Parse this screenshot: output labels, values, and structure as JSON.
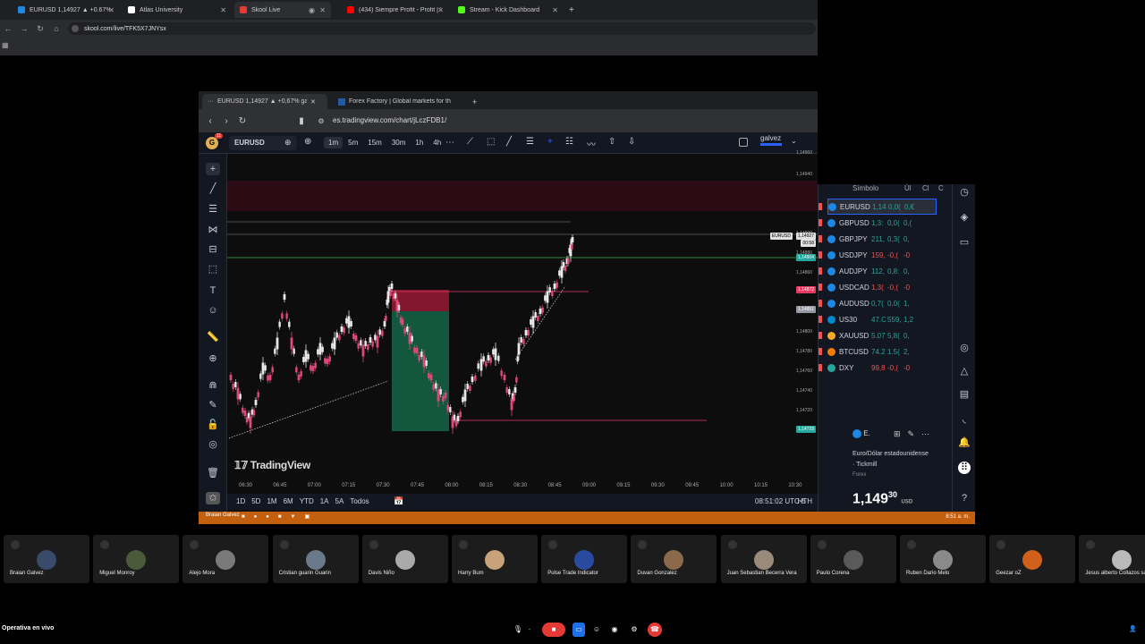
{
  "browser": {
    "tabs": [
      {
        "label": "EURUSD 1,14927 ▲ +0.67% Wi",
        "active": false,
        "color": "#1e88e5"
      },
      {
        "label": "Atlas University",
        "active": false,
        "color": "#ffffff"
      },
      {
        "label": "Skool Live",
        "active": true,
        "color": "#e53935"
      },
      {
        "label": "(434) Siempre Profit - Profit | Ti",
        "active": false,
        "color": "#ff0000"
      },
      {
        "label": "Stream - Kick Dashboard",
        "active": false,
        "color": "#53fc18"
      }
    ],
    "url": "skool.com/live/TFK5X7JNYsx"
  },
  "inner_browser": {
    "tabs": [
      {
        "label": "EURUSD 1,14927 ▲ +0,67% galv"
      },
      {
        "label": "Forex Factory | Global markets for th"
      }
    ],
    "url": "es.tradingview.com/chart/jLczFDB1/"
  },
  "tv": {
    "avatar_badge": "11",
    "symbol": "EURUSD",
    "timeframes": [
      "1m",
      "5m",
      "15m",
      "30m",
      "1h",
      "4h"
    ],
    "active_timeframe": "1m",
    "user": "galvez",
    "logo": "TradingView",
    "ranges": [
      "1D",
      "5D",
      "1M",
      "6M",
      "YTD",
      "1A",
      "5A",
      "Todos"
    ],
    "clock": "08:51:02 UTC-5",
    "hth": "HTH",
    "price_ticks": [
      "1,14960",
      "1,14940",
      "1,14900",
      "1,14880",
      "1,14860",
      "1,14840",
      "1,14820",
      "1,14800",
      "1,14780",
      "1,14760",
      "1,14740",
      "1,14720",
      "1,14700"
    ],
    "badges": {
      "current_label": "EURUSD",
      "current": "1,14927",
      "countdown": "00:58",
      "green": "1,14904",
      "red": "1,14872",
      "grey": "1,14851",
      "low": "1,14729"
    },
    "time_ticks": [
      "06:30",
      "06:45",
      "07:00",
      "07:15",
      "07:30",
      "07:45",
      "08:00",
      "08:15",
      "08:30",
      "08:45",
      "09:00",
      "09:15",
      "09:30",
      "09:45",
      "10:00",
      "10:15",
      "10:30"
    ]
  },
  "watchlist": {
    "headers": {
      "symbol": "Símbolo",
      "last": "Úl",
      "chg": "Cl",
      "chgp": "C"
    },
    "rows": [
      {
        "sym": "EURUSD",
        "last": "1,14",
        "chg": "0,0(",
        "chgp": "0,€",
        "up": true,
        "color": "#1e88e5"
      },
      {
        "sym": "GBPUSD",
        "last": "1,3:",
        "chg": "0,0(",
        "chgp": "0,(",
        "up": true,
        "color": "#1e88e5"
      },
      {
        "sym": "GBPJPY",
        "last": "211,",
        "chg": "0,3(",
        "chgp": "0,",
        "up": true,
        "color": "#1e88e5"
      },
      {
        "sym": "USDJPY",
        "last": "159,",
        "chg": "-0,(",
        "chgp": "-0",
        "up": false,
        "color": "#1e88e5"
      },
      {
        "sym": "AUDJPY",
        "last": "112,",
        "chg": "0,8:",
        "chgp": "0,",
        "up": true,
        "color": "#1e88e5"
      },
      {
        "sym": "USDCAD",
        "last": "1,3(",
        "chg": "-0,(",
        "chgp": "-0",
        "up": false,
        "color": "#1e88e5"
      },
      {
        "sym": "AUDUSD",
        "last": "0,7(",
        "chg": "0,0(",
        "chgp": "1,",
        "up": true,
        "color": "#1e88e5"
      },
      {
        "sym": "US30",
        "last": "47.C",
        "chg": "559,",
        "chgp": "1,2",
        "up": true,
        "color": "#0288d1"
      },
      {
        "sym": "XAUUSD",
        "last": "5.07",
        "chg": "5,8(",
        "chgp": "0,",
        "up": true,
        "color": "#f9a825"
      },
      {
        "sym": "BTCUSD",
        "last": "74.2",
        "chg": "1.5(",
        "chgp": "2,",
        "up": true,
        "color": "#f57c00"
      },
      {
        "sym": "DXY",
        "last": "99,8",
        "chg": "-0,(",
        "chgp": "-0",
        "up": false,
        "color": "#26a69a"
      }
    ],
    "detail": {
      "short": "E.",
      "name": "Euro/Dólar estadounidense",
      "exchange": "· Tickmill",
      "type": "Forex",
      "price_main": "1,149",
      "price_sup": "30",
      "currency": "USD"
    }
  },
  "taskbar": {
    "name": "Braian Galvez",
    "time": "8:51 a. m."
  },
  "participants": [
    {
      "name": "Braian Galvez",
      "color": "#3a4a6a"
    },
    {
      "name": "Miguel Monroy",
      "color": "#4a5a3a"
    },
    {
      "name": "Alejo Mora",
      "color": "#7a7a7a"
    },
    {
      "name": "Cristian guarin Guarin",
      "color": "#6a7a8a"
    },
    {
      "name": "Davis Niño",
      "color": "#aaaaaa"
    },
    {
      "name": "Harry Bum",
      "color": "#c8a27a"
    },
    {
      "name": "Pulse Trade Indicator",
      "color": "#2a4aa0"
    },
    {
      "name": "Duvan Gonzalez",
      "color": "#8a6a4a"
    },
    {
      "name": "Juan Sebastian Becerra Vera",
      "color": "#9a8a7a"
    },
    {
      "name": "Paulo Corena",
      "color": "#5a5a5a"
    },
    {
      "name": "Ruben Dario Melo",
      "color": "#8a8a8a"
    },
    {
      "name": "Geezar oZ",
      "color": "#d0601a"
    },
    {
      "name": "Jesus alberto Collazos salazar",
      "color": "#bbbbbb"
    }
  ],
  "footer": {
    "label": "Operativa en vivo"
  }
}
